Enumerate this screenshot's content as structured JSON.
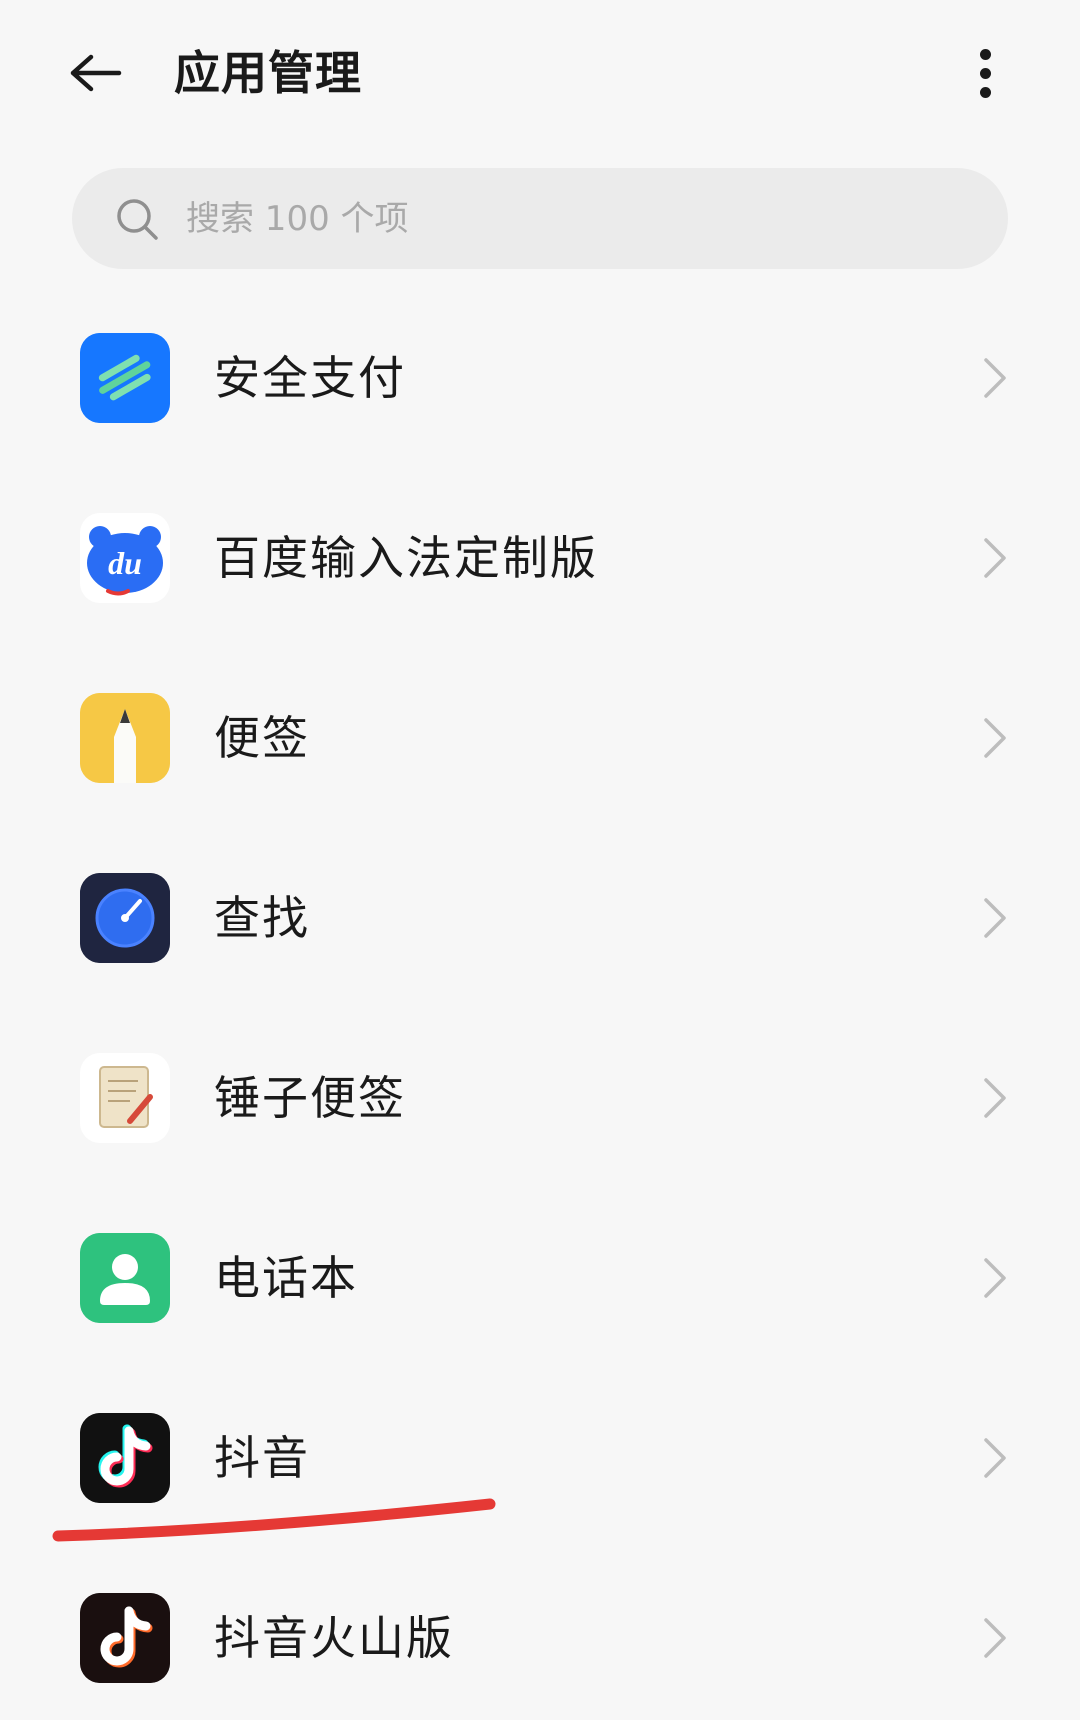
{
  "header": {
    "title": "应用管理",
    "back_icon": "arrow-left-icon",
    "more_icon": "more-vertical-icon"
  },
  "search": {
    "placeholder": "搜索 100 个项",
    "value": "",
    "icon": "search-icon"
  },
  "apps": [
    {
      "name": "安全支付",
      "icon": "secure-pay-icon",
      "color": "#1677ff"
    },
    {
      "name": "百度输入法定制版",
      "icon": "baidu-input-icon",
      "color": "#2a6df4"
    },
    {
      "name": "便签",
      "icon": "notes-icon",
      "color": "#f6c845"
    },
    {
      "name": "查找",
      "icon": "find-device-icon",
      "color": "#1f2540"
    },
    {
      "name": "锤子便签",
      "icon": "smartisan-notes-icon",
      "color": "#efe3c8"
    },
    {
      "name": "电话本",
      "icon": "contacts-icon",
      "color": "#2ec27e"
    },
    {
      "name": "抖音",
      "icon": "douyin-icon",
      "color": "#111111"
    },
    {
      "name": "抖音火山版",
      "icon": "douyin-volcano-icon",
      "color": "#1a0f0f"
    }
  ],
  "colors": {
    "background": "#f7f7f7",
    "search_bg": "#ebebeb",
    "annotation_red": "#e53935",
    "chevron": "#bdbdbd"
  }
}
